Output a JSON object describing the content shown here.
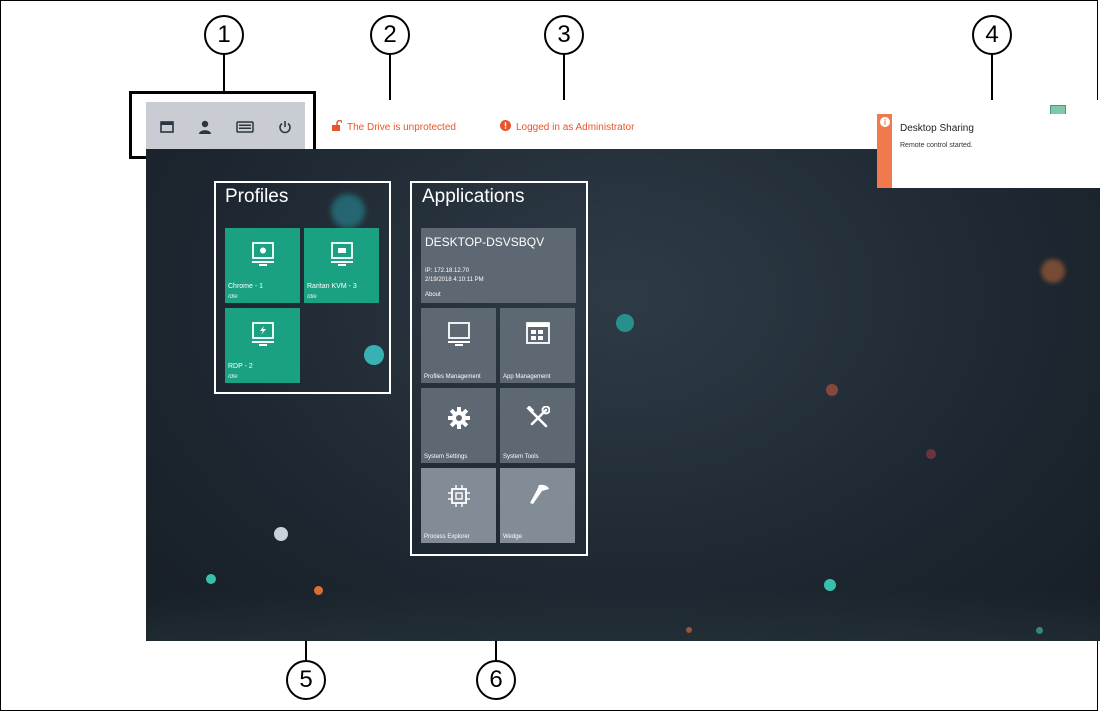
{
  "callouts": [
    "1",
    "2",
    "3",
    "4",
    "5",
    "6"
  ],
  "toolbar": {
    "icons": [
      "window-icon",
      "user-icon",
      "keyboard-icon",
      "power-icon"
    ]
  },
  "status": {
    "drive": "The Drive is unprotected",
    "login": "Logged in as Administrator"
  },
  "notification": {
    "icon": "i",
    "title": "Desktop Sharing",
    "message": "Remote control started."
  },
  "profiles": {
    "title": "Profiles",
    "items": [
      {
        "name": "Chrome - 1",
        "status": "Idle"
      },
      {
        "name": "Raritan KVM - 3",
        "status": "Idle"
      },
      {
        "name": "RDP - 2",
        "status": "Idle"
      }
    ]
  },
  "applications": {
    "title": "Applications",
    "device": {
      "name": "DESKTOP-DSVSBQV",
      "ip": "IP: 172.18.12.70",
      "datetime": "2/19/2018 4:10:11 PM",
      "link": "About"
    },
    "tiles": [
      {
        "label": "Profiles Management",
        "icon": "monitor-icon"
      },
      {
        "label": "App Management",
        "icon": "app-grid-icon"
      },
      {
        "label": "System Settings",
        "icon": "gear-icon"
      },
      {
        "label": "System Tools",
        "icon": "tools-icon"
      },
      {
        "label": "Process Explorer",
        "icon": "chip-icon"
      },
      {
        "label": "Wedge",
        "icon": "scanner-icon"
      }
    ]
  },
  "colors": {
    "accent_green": "#1aa182",
    "alert_orange": "#e8552a",
    "tile_grey": "#5e6872",
    "tile_light": "#818c97"
  }
}
